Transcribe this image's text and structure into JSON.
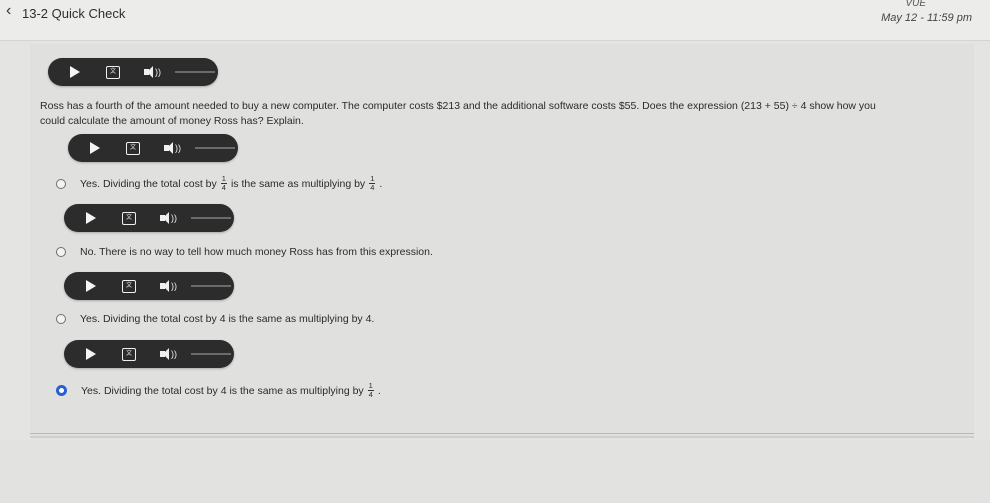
{
  "header": {
    "back_icon": "chevron-left-icon",
    "title": "13-2 Quick Check",
    "meta_top": "VUE",
    "date": "May 12 - 11:59 pm"
  },
  "question": {
    "text_part1": "Ross has a fourth of the amount needed to buy a new computer. The computer costs $213 and the additional software costs $55. Does the expression (213 + 55) ÷ 4 show how you",
    "text_part2": "could calculate the amount of money Ross has? Explain."
  },
  "choices": [
    {
      "pre": "Yes. Dividing the total cost by",
      "num": "1",
      "den": "4",
      "mid": "is the same as multiplying by",
      "num2": "1",
      "den2": "4",
      "post": "."
    },
    {
      "text": "No. There is no way to tell how much money Ross has from this expression."
    },
    {
      "text": "Yes. Dividing the total cost by 4 is the same as multiplying by 4."
    },
    {
      "pre": "Yes. Dividing the total cost by 4 is the same as multiplying by",
      "num": "1",
      "den": "4",
      "post": "."
    }
  ],
  "selected_choice_index": 3,
  "accent_color": "#2a5fd0"
}
